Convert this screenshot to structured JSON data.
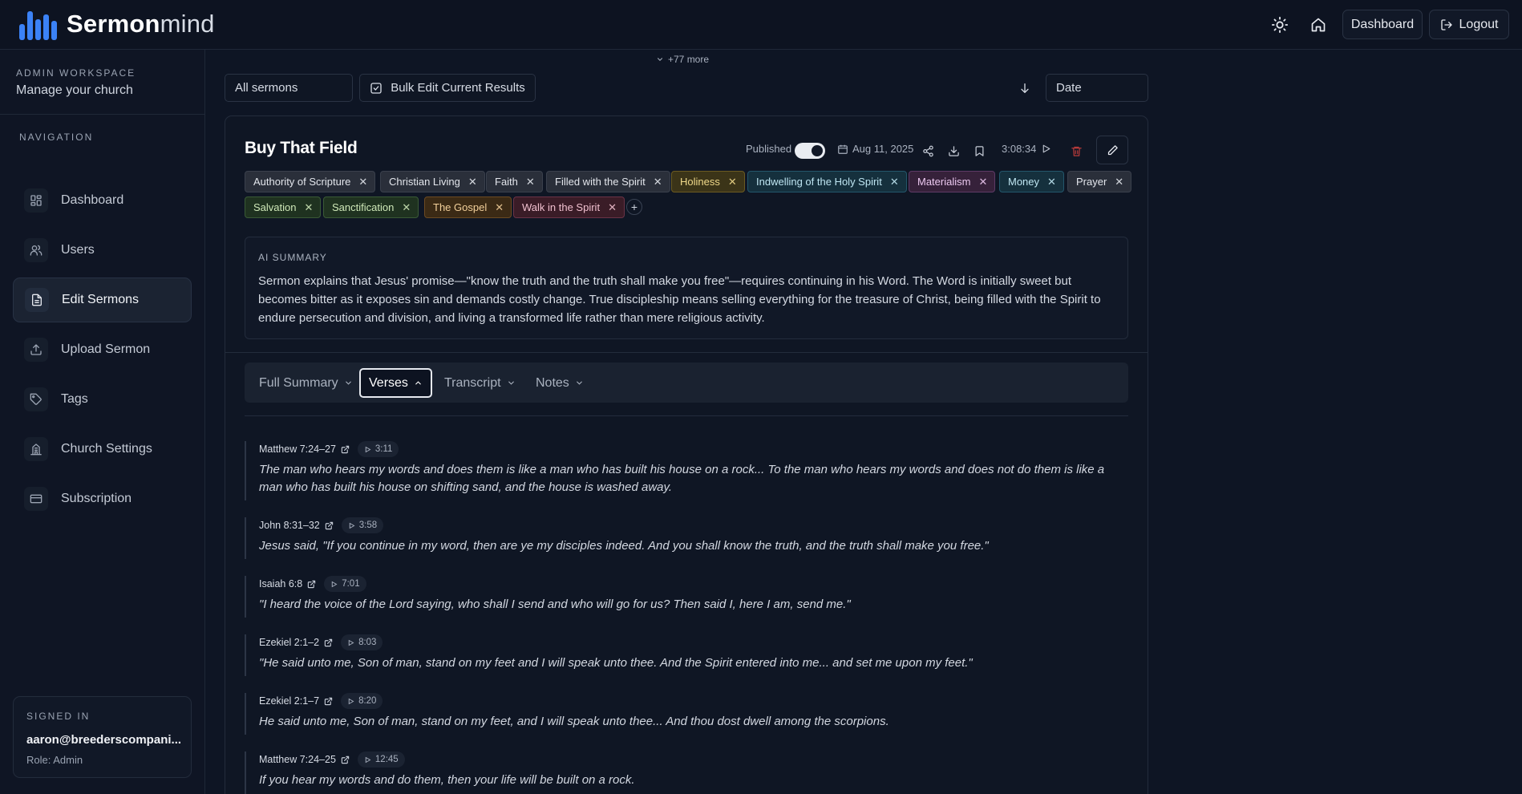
{
  "header": {
    "brand_bold": "Sermon",
    "brand_light": "mind",
    "dashboard_label": "Dashboard",
    "logout_label": "Logout",
    "icons": [
      "sun-icon",
      "home-icon",
      "logout-icon"
    ]
  },
  "sidebar": {
    "workspace_label": "ADMIN WORKSPACE",
    "workspace_name": "Manage your church",
    "nav_label": "NAVIGATION",
    "items": [
      {
        "label": "Dashboard",
        "icon": "grid-icon"
      },
      {
        "label": "Users",
        "icon": "users-icon"
      },
      {
        "label": "Edit Sermons",
        "icon": "file-icon",
        "active": true
      },
      {
        "label": "Upload Sermon",
        "icon": "upload-icon"
      },
      {
        "label": "Tags",
        "icon": "tag-icon"
      },
      {
        "label": "Church Settings",
        "icon": "church-icon"
      },
      {
        "label": "Subscription",
        "icon": "credit-card-icon"
      }
    ],
    "signed_in": {
      "label": "SIGNED IN",
      "email": "aaron@breederscompani...",
      "role": "Role: Admin"
    }
  },
  "toolbar": {
    "more": "+77 more",
    "filter_value": "All sermons",
    "bulk_edit_label": "Bulk Edit Current Results",
    "sort_value": "Date"
  },
  "sermon": {
    "title": "Buy That Field",
    "published_label": "Published",
    "published": true,
    "date": "Aug 11, 2025",
    "duration": "3:08:34",
    "tags": [
      {
        "label": "Authority of Scripture",
        "color": "#2a2f3a"
      },
      {
        "label": "Christian Living",
        "color": "#2a2f3a"
      },
      {
        "label": "Faith",
        "color": "#2a2f3a"
      },
      {
        "label": "Filled with the Spirit",
        "color": "#2a2f3a"
      },
      {
        "label": "Holiness",
        "color": "#3b3418"
      },
      {
        "label": "Indwelling of the Holy Spirit",
        "color": "#15303d"
      },
      {
        "label": "Materialism",
        "color": "#36213a"
      },
      {
        "label": "Money",
        "color": "#15303d"
      },
      {
        "label": "Prayer",
        "color": "#2a2f3a"
      },
      {
        "label": "Salvation",
        "color": "#1f3220"
      },
      {
        "label": "Sanctification",
        "color": "#1f3220"
      },
      {
        "label": "The Gospel",
        "color": "#3b2a15"
      },
      {
        "label": "Walk in the Spirit",
        "color": "#3a1c27"
      }
    ],
    "ai_summary_label": "AI SUMMARY",
    "ai_summary": "Sermon explains that Jesus' promise—\"know the truth and the truth shall make you free\"—requires continuing in his Word. The Word is initially sweet but becomes bitter as it exposes sin and demands costly change. True discipleship means selling everything for the treasure of Christ, being filled with the Spirit to endure persecution and division, and living a transformed life rather than mere religious activity."
  },
  "tabs": [
    {
      "label": "Full Summary",
      "active": false
    },
    {
      "label": "Verses",
      "active": true
    },
    {
      "label": "Transcript",
      "active": false
    },
    {
      "label": "Notes",
      "active": false
    }
  ],
  "verses": [
    {
      "ref": "Matthew 7:24–27",
      "time": "3:11",
      "text": "The man who hears my words and does them is like a man who has built his house on a rock... To the man who hears my words and does not do them is like a man who has built his house on shifting sand, and the house is washed away."
    },
    {
      "ref": "John 8:31–32",
      "time": "3:58",
      "text": "Jesus said, \"If you continue in my word, then are ye my disciples indeed. And you shall know the truth, and the truth shall make you free.\""
    },
    {
      "ref": "Isaiah 6:8",
      "time": "7:01",
      "text": "\"I heard the voice of the Lord saying, who shall I send and who will go for us? Then said I, here I am, send me.\""
    },
    {
      "ref": "Ezekiel 2:1–2",
      "time": "8:03",
      "text": "\"He said unto me, Son of man, stand on my feet and I will speak unto thee. And the Spirit entered into me... and set me upon my feet.\""
    },
    {
      "ref": "Ezekiel 2:1–7",
      "time": "8:20",
      "text": "He said unto me, Son of man, stand on my feet, and I will speak unto thee... And thou dost dwell among the scorpions."
    },
    {
      "ref": "Matthew 7:24–25",
      "time": "12:45",
      "text": "If you hear my words and do them, then your life will be built on a rock."
    }
  ]
}
